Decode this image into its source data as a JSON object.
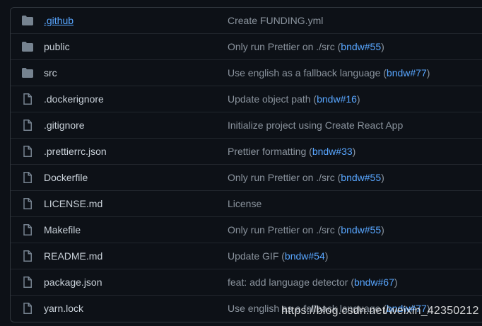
{
  "files": [
    {
      "name": "github_dir",
      "label": ".github",
      "type": "folder",
      "message": "Create FUNDING.yml",
      "ref": ""
    },
    {
      "name": "public",
      "label": "public",
      "type": "folder",
      "message": "Only run Prettier on ./src (",
      "ref": "bndw#55"
    },
    {
      "name": "src",
      "label": "src",
      "type": "folder",
      "message": "Use english as a fallback language (",
      "ref": "bndw#77"
    },
    {
      "name": "dockerignore",
      "label": ".dockerignore",
      "type": "file",
      "message": "Update object path (",
      "ref": "bndw#16"
    },
    {
      "name": "gitignore",
      "label": ".gitignore",
      "type": "file",
      "message": "Initialize project using Create React App",
      "ref": ""
    },
    {
      "name": "prettierrc",
      "label": ".prettierrc.json",
      "type": "file",
      "message": "Prettier formatting (",
      "ref": "bndw#33"
    },
    {
      "name": "dockerfile",
      "label": "Dockerfile",
      "type": "file",
      "message": "Only run Prettier on ./src (",
      "ref": "bndw#55"
    },
    {
      "name": "license",
      "label": "LICENSE.md",
      "type": "file",
      "message": "License",
      "ref": ""
    },
    {
      "name": "makefile",
      "label": "Makefile",
      "type": "file",
      "message": "Only run Prettier on ./src (",
      "ref": "bndw#55"
    },
    {
      "name": "readme",
      "label": "README.md",
      "type": "file",
      "message": "Update GIF (",
      "ref": "bndw#54"
    },
    {
      "name": "package-json",
      "label": "package.json",
      "type": "file",
      "message": "feat: add language detector (",
      "ref": "bndw#67"
    },
    {
      "name": "yarn-lock",
      "label": "yarn.lock",
      "type": "file",
      "message": "Use english as a fallback language (",
      "ref": "bndw#77"
    }
  ],
  "closing_paren": ")",
  "watermark": "https://blog.csdn.net/weixin_42350212",
  "colors": {
    "background": "#0d1117",
    "border": "#30363d",
    "link": "#58a6ff",
    "text": "#c9d1d9",
    "muted": "#8b949e"
  }
}
